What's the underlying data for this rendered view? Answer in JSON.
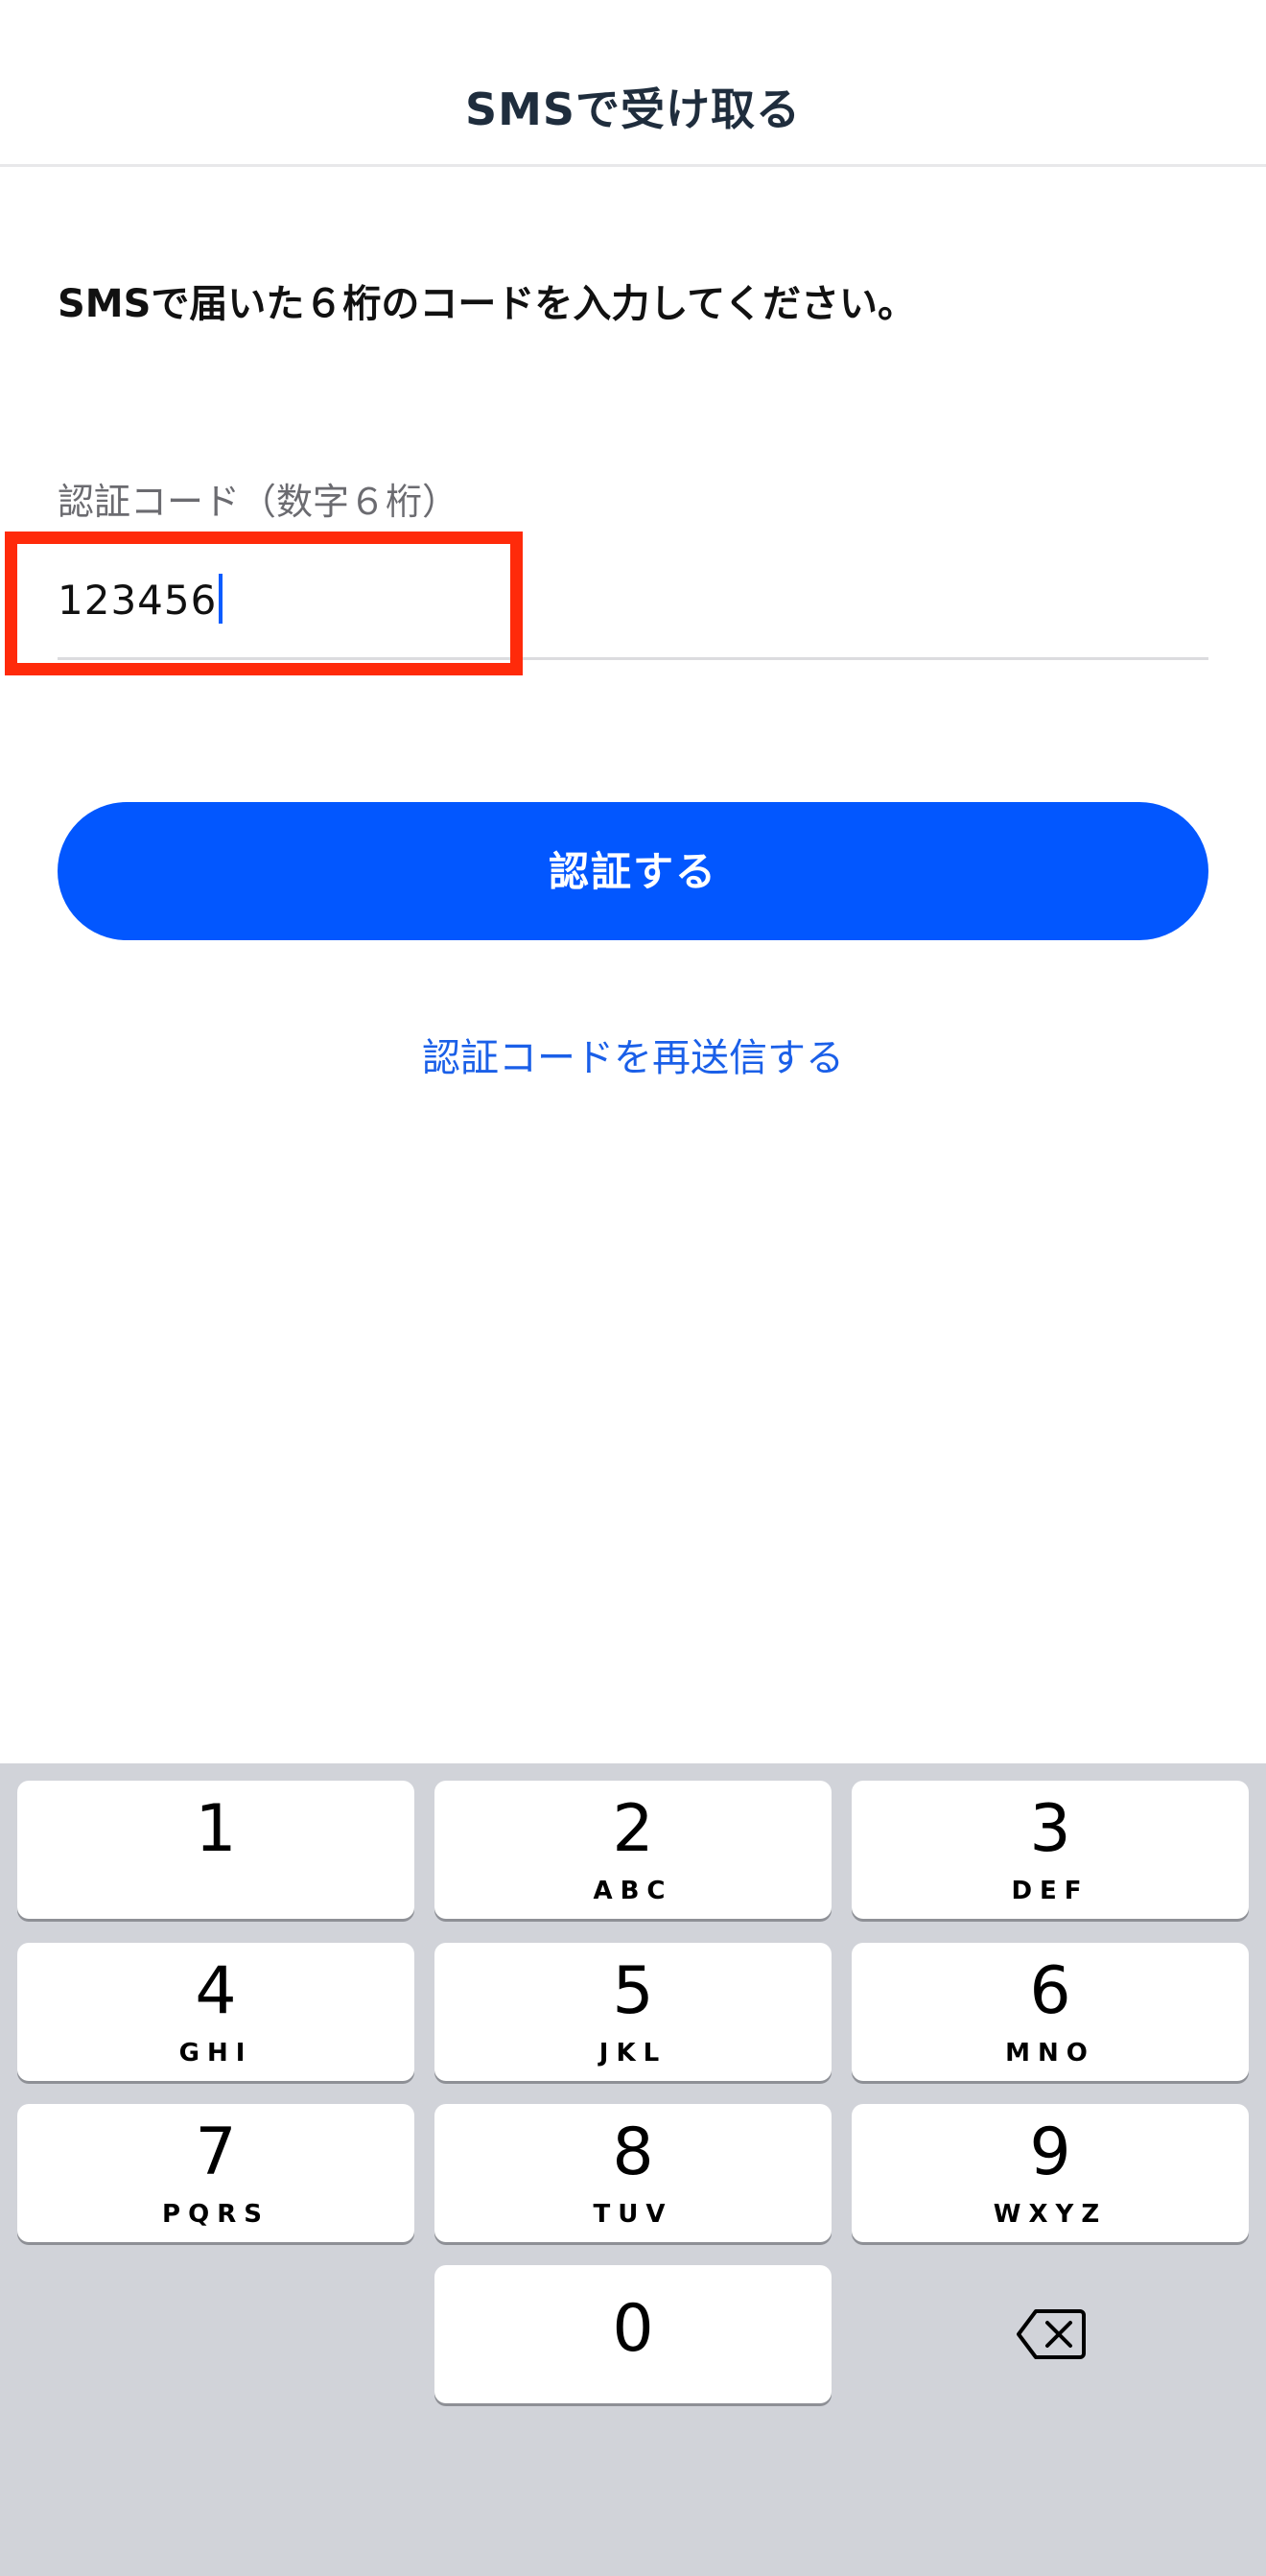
{
  "header": {
    "title": "SMSで受け取る"
  },
  "instruction": "SMSで届いた６桁のコードを入力してください。",
  "code_field": {
    "label": "認証コード（数字６桁）",
    "value": "123456"
  },
  "verify_button": {
    "label": "認証する"
  },
  "resend_link": {
    "label": "認証コードを再送信する"
  },
  "keypad": {
    "keys": [
      {
        "digit": "1",
        "letters": ""
      },
      {
        "digit": "2",
        "letters": "ABC"
      },
      {
        "digit": "3",
        "letters": "DEF"
      },
      {
        "digit": "4",
        "letters": "GHI"
      },
      {
        "digit": "5",
        "letters": "JKL"
      },
      {
        "digit": "6",
        "letters": "MNO"
      },
      {
        "digit": "7",
        "letters": "PQRS"
      },
      {
        "digit": "8",
        "letters": "TUV"
      },
      {
        "digit": "9",
        "letters": "WXYZ"
      },
      {
        "digit": "0",
        "letters": ""
      }
    ],
    "backspace_icon": "backspace-icon"
  },
  "colors": {
    "accent": "#0257ff",
    "link": "#1a5fe8",
    "highlight": "#ff2a0a",
    "keyboard_bg": "#d1d3d9"
  }
}
